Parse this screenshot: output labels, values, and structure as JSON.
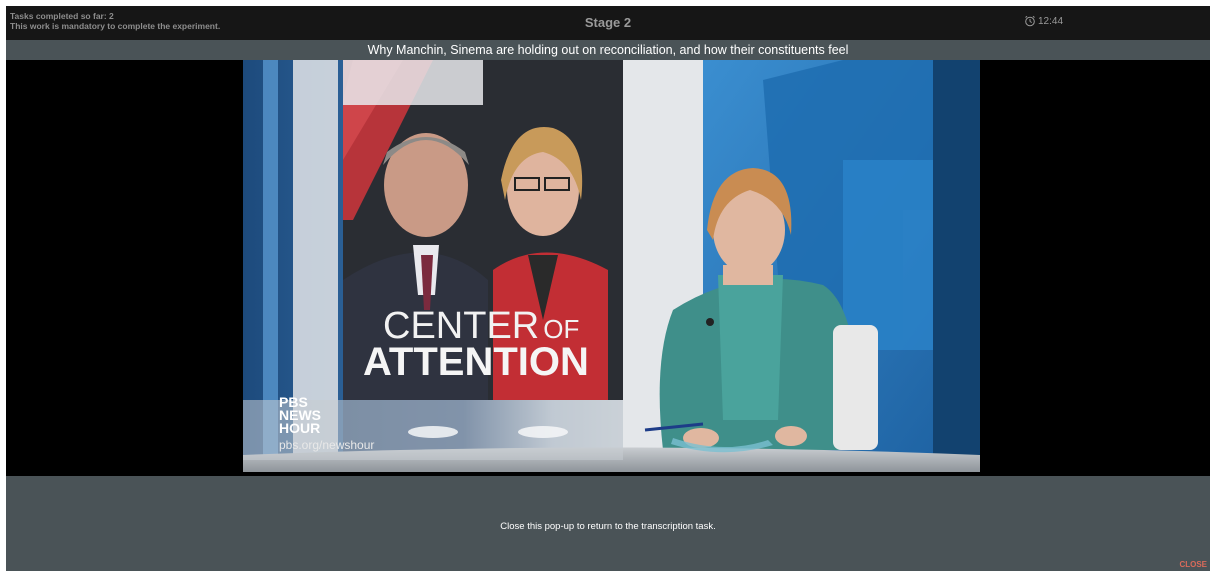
{
  "header": {
    "tasks_completed": "Tasks completed so far: 2",
    "mandatory_note": "This work is mandatory to complete the experiment.",
    "stage": "Stage 2",
    "timer": "12:44",
    "timer_icon": "alarm-clock-icon"
  },
  "video": {
    "title": "Why Manchin, Sinema are holding out on reconciliation, and how their constituents feel",
    "graphic_line1": "CENTER",
    "graphic_line1_small": "OF",
    "graphic_line2": "ATTENTION",
    "logo_line1": "PBS",
    "logo_line2": "NEWS",
    "logo_line3": "HOUR",
    "website": "pbs.org/newshour"
  },
  "footer": {
    "message": "Close this pop-up to return to the transcription task.",
    "close_label": "CLOSE"
  },
  "colors": {
    "topbar": "#161616",
    "titlebar": "#4a5357",
    "close": "#d96a5a"
  }
}
